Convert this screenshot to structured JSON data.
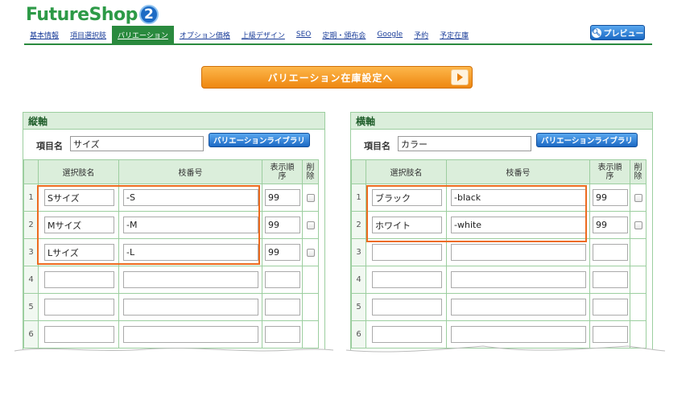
{
  "app": {
    "logo_text": "FutureShop",
    "logo_badge": "2"
  },
  "nav": {
    "items": [
      "基本情報",
      "項目選択肢",
      "バリエーション",
      "オプション価格",
      "上級デザイン",
      "SEO",
      "定期・頒布会",
      "Google",
      "予約",
      "予定在庫"
    ],
    "active_index": 2
  },
  "preview_button": "プレビュー",
  "stock_button": "バリエーション在庫設定へ",
  "panels": {
    "vertical": {
      "title": "縦軸",
      "item_label": "項目名",
      "item_value": "サイズ",
      "library_button": "バリエーションライブラリ",
      "rows": [
        {
          "num": "1",
          "name": "Sサイズ",
          "code": "-S",
          "order": "99"
        },
        {
          "num": "2",
          "name": "Mサイズ",
          "code": "-M",
          "order": "99"
        },
        {
          "num": "3",
          "name": "Lサイズ",
          "code": "-L",
          "order": "99"
        },
        {
          "num": "4",
          "name": "",
          "code": "",
          "order": ""
        },
        {
          "num": "5",
          "name": "",
          "code": "",
          "order": ""
        },
        {
          "num": "6",
          "name": "",
          "code": "",
          "order": ""
        }
      ]
    },
    "horizontal": {
      "title": "横軸",
      "item_label": "項目名",
      "item_value": "カラー",
      "library_button": "バリエーションライブラリ",
      "rows": [
        {
          "num": "1",
          "name": "ブラック",
          "code": "-black",
          "order": "99"
        },
        {
          "num": "2",
          "name": "ホワイト",
          "code": "-white",
          "order": "99"
        },
        {
          "num": "3",
          "name": "",
          "code": "",
          "order": ""
        },
        {
          "num": "4",
          "name": "",
          "code": "",
          "order": ""
        },
        {
          "num": "5",
          "name": "",
          "code": "",
          "order": ""
        },
        {
          "num": "6",
          "name": "",
          "code": "",
          "order": ""
        }
      ]
    }
  },
  "columns": {
    "name": "選択肢名",
    "code": "枝番号",
    "order": "表示順序",
    "delete": "削除"
  },
  "colors": {
    "brand_green": "#2a8a3e",
    "highlight": "#ec6b1f",
    "button_blue": "#1b69c4",
    "button_orange": "#ee8710"
  }
}
